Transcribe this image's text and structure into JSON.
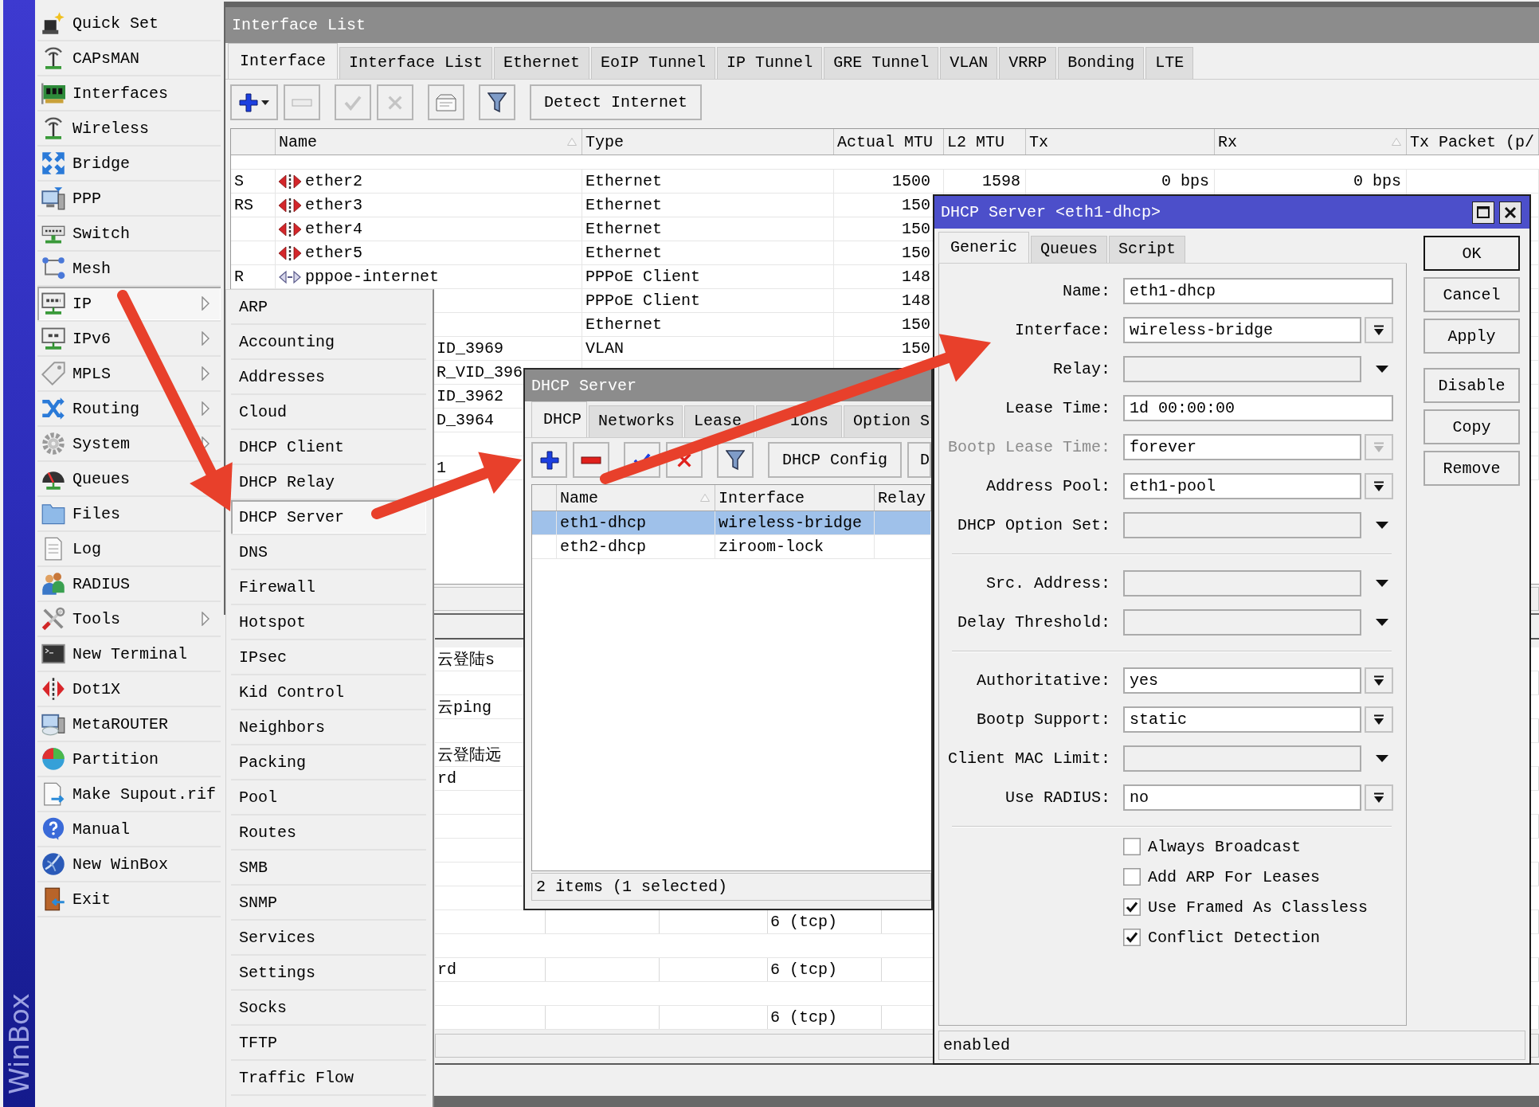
{
  "banner": {
    "title": "WinBox"
  },
  "main_menu": {
    "items": [
      {
        "label": "Quick Set",
        "submenu": false,
        "selected": false
      },
      {
        "label": "CAPsMAN",
        "submenu": false,
        "selected": false
      },
      {
        "label": "Interfaces",
        "submenu": false,
        "selected": false
      },
      {
        "label": "Wireless",
        "submenu": false,
        "selected": false
      },
      {
        "label": "Bridge",
        "submenu": false,
        "selected": false
      },
      {
        "label": "PPP",
        "submenu": false,
        "selected": false
      },
      {
        "label": "Switch",
        "submenu": false,
        "selected": false
      },
      {
        "label": "Mesh",
        "submenu": false,
        "selected": false
      },
      {
        "label": "IP",
        "submenu": true,
        "selected": true
      },
      {
        "label": "IPv6",
        "submenu": true,
        "selected": false
      },
      {
        "label": "MPLS",
        "submenu": true,
        "selected": false
      },
      {
        "label": "Routing",
        "submenu": true,
        "selected": false
      },
      {
        "label": "System",
        "submenu": true,
        "selected": false
      },
      {
        "label": "Queues",
        "submenu": false,
        "selected": false
      },
      {
        "label": "Files",
        "submenu": false,
        "selected": false
      },
      {
        "label": "Log",
        "submenu": false,
        "selected": false
      },
      {
        "label": "RADIUS",
        "submenu": false,
        "selected": false
      },
      {
        "label": "Tools",
        "submenu": true,
        "selected": false
      },
      {
        "label": "New Terminal",
        "submenu": false,
        "selected": false
      },
      {
        "label": "Dot1X",
        "submenu": false,
        "selected": false
      },
      {
        "label": "MetaROUTER",
        "submenu": false,
        "selected": false
      },
      {
        "label": "Partition",
        "submenu": false,
        "selected": false
      },
      {
        "label": "Make Supout.rif",
        "submenu": false,
        "selected": false
      },
      {
        "label": "Manual",
        "submenu": false,
        "selected": false
      },
      {
        "label": "New WinBox",
        "submenu": false,
        "selected": false
      },
      {
        "label": "Exit",
        "submenu": false,
        "selected": false
      }
    ]
  },
  "ip_submenu": {
    "items": [
      {
        "label": "ARP",
        "selected": false
      },
      {
        "label": "Accounting",
        "selected": false
      },
      {
        "label": "Addresses",
        "selected": false
      },
      {
        "label": "Cloud",
        "selected": false
      },
      {
        "label": "DHCP Client",
        "selected": false
      },
      {
        "label": "DHCP Relay",
        "selected": false
      },
      {
        "label": "DHCP Server",
        "selected": true
      },
      {
        "label": "DNS",
        "selected": false
      },
      {
        "label": "Firewall",
        "selected": false
      },
      {
        "label": "Hotspot",
        "selected": false
      },
      {
        "label": "IPsec",
        "selected": false
      },
      {
        "label": "Kid Control",
        "selected": false
      },
      {
        "label": "Neighbors",
        "selected": false
      },
      {
        "label": "Packing",
        "selected": false
      },
      {
        "label": "Pool",
        "selected": false
      },
      {
        "label": "Routes",
        "selected": false
      },
      {
        "label": "SMB",
        "selected": false
      },
      {
        "label": "SNMP",
        "selected": false
      },
      {
        "label": "Services",
        "selected": false
      },
      {
        "label": "Settings",
        "selected": false
      },
      {
        "label": "Socks",
        "selected": false
      },
      {
        "label": "TFTP",
        "selected": false
      },
      {
        "label": "Traffic Flow",
        "selected": false
      }
    ]
  },
  "interface_window": {
    "title": "Interface List",
    "active": false,
    "tabs": [
      {
        "label": "Interface",
        "selected": true
      },
      {
        "label": "Interface List",
        "selected": false
      },
      {
        "label": "Ethernet",
        "selected": false
      },
      {
        "label": "EoIP Tunnel",
        "selected": false
      },
      {
        "label": "IP Tunnel",
        "selected": false
      },
      {
        "label": "GRE Tunnel",
        "selected": false
      },
      {
        "label": "VLAN",
        "selected": false
      },
      {
        "label": "VRRP",
        "selected": false
      },
      {
        "label": "Bonding",
        "selected": false
      },
      {
        "label": "LTE",
        "selected": false
      }
    ],
    "toolbar": [
      {
        "kind": "addmenu",
        "disabled": false
      },
      {
        "kind": "remove",
        "disabled": true
      },
      {
        "kind": "enable",
        "disabled": true
      },
      {
        "kind": "disable",
        "disabled": true
      },
      {
        "kind": "comment",
        "disabled": false
      },
      {
        "kind": "filter",
        "disabled": false
      },
      {
        "kind": "text",
        "label": "Detect Internet",
        "disabled": false
      }
    ],
    "table": {
      "columns": [
        {
          "label": "Name",
          "sorted": true
        },
        {
          "label": "Type",
          "sorted": false
        },
        {
          "label": "Actual MTU",
          "sorted": false
        },
        {
          "label": "L2 MTU",
          "sorted": false
        },
        {
          "label": "Tx",
          "sorted": false
        },
        {
          "label": "Rx",
          "sorted": true
        },
        {
          "label": "Tx Packet (p/",
          "sorted": false
        }
      ],
      "rows": [
        {
          "flags": "S",
          "kind": "ethernet",
          "name": "ether2",
          "type": "Ethernet",
          "actual_mtu": "1500",
          "l2_mtu": "1598",
          "tx": "0 bps",
          "rx": "0 bps"
        },
        {
          "flags": "RS",
          "kind": "ethernet",
          "name": "ether3",
          "type": "Ethernet",
          "actual_mtu": "150"
        },
        {
          "kind": "ethernet",
          "name": "ether4",
          "type": "Ethernet",
          "actual_mtu": "150"
        },
        {
          "kind": "ethernet",
          "name": "ether5",
          "type": "Ethernet",
          "actual_mtu": "150"
        },
        {
          "flags": "R",
          "kind": "pppoe",
          "name": "pppoe-internet",
          "type": "PPPoE Client",
          "actual_mtu": "148"
        },
        {
          "type": "PPPoE Client",
          "actual_mtu": "148"
        },
        {
          "type": "Ethernet",
          "actual_mtu": "150"
        },
        {
          "name": "ID_3969",
          "type": "VLAN",
          "actual_mtu": "150"
        },
        {
          "name": "R_VID_396"
        },
        {
          "name": "ID_3962"
        },
        {
          "name": "D_3964"
        },
        {},
        {
          "name": "1"
        }
      ]
    }
  },
  "rule_window": {
    "rows": [
      {
        "kind": "comment",
        "column_1": "云登陆s"
      },
      {
        "kind": "rule"
      },
      {
        "kind": "comment",
        "column_1": "云ping"
      },
      {
        "kind": "rule"
      },
      {
        "kind": "comment",
        "column_1": "云登陆远"
      },
      {
        "kind": "rule",
        "column_1": "rd"
      },
      {
        "kind": "comment"
      },
      {
        "kind": "rule"
      },
      {
        "kind": "comment"
      },
      {
        "kind": "rule"
      },
      {
        "kind": "comment"
      },
      {
        "kind": "rule",
        "column_4": "6 (tcp)"
      },
      {
        "kind": "comment"
      },
      {
        "kind": "rule",
        "column_1": "rd",
        "column_4": "6 (tcp)"
      },
      {
        "kind": "comment"
      },
      {
        "kind": "rule",
        "column_4": "6 (tcp)"
      }
    ]
  },
  "dhcp_list_window": {
    "title": "DHCP Server",
    "active": false,
    "tabs": [
      {
        "label": "DHCP",
        "selected": true
      },
      {
        "label": "Networks",
        "selected": false
      },
      {
        "label": "Lease",
        "selected": false
      },
      {
        "label": "ions",
        "selected": false
      },
      {
        "label": "Option S",
        "selected": false
      }
    ],
    "toolbar": [
      {
        "kind": "add",
        "disabled": false
      },
      {
        "kind": "remove",
        "disabled": false
      },
      {
        "kind": "enable",
        "disabled": false
      },
      {
        "kind": "disable",
        "disabled": false
      },
      {
        "kind": "filter",
        "disabled": false
      },
      {
        "kind": "text",
        "label": "DHCP Config",
        "disabled": false
      },
      {
        "kind": "text",
        "label": "D",
        "disabled": false
      }
    ],
    "table": {
      "columns": [
        {
          "label": "Name",
          "sorted": true
        },
        {
          "label": "Interface",
          "sorted": false
        },
        {
          "label": "Relay",
          "sorted": false
        }
      ],
      "rows": [
        {
          "name": "eth1-dhcp",
          "interface": "wireless-bridge",
          "selected": true
        },
        {
          "name": "eth2-dhcp",
          "interface": "ziroom-lock",
          "selected": false
        }
      ]
    },
    "footer": "2 items (1 selected)"
  },
  "dhcp_dialog": {
    "title": "DHCP Server <eth1-dhcp>",
    "active": true,
    "tabs": [
      {
        "label": "Generic",
        "selected": true
      },
      {
        "label": "Queues",
        "selected": false
      },
      {
        "label": "Script",
        "selected": false
      }
    ],
    "sections": [
      [
        {
          "label": "Name:",
          "kind": "text",
          "value": "eth1-dhcp",
          "disabled": false
        },
        {
          "label": "Interface:",
          "kind": "combo",
          "value": "wireless-bridge",
          "disabled": false
        },
        {
          "label": "Relay:",
          "kind": "optional",
          "disabled": false
        },
        {
          "label": "Lease Time:",
          "kind": "text",
          "value": "1d 00:00:00",
          "disabled": false
        },
        {
          "label": "Bootp Lease Time:",
          "kind": "combo",
          "value": "forever",
          "disabled": true
        },
        {
          "label": "Address Pool:",
          "kind": "combo",
          "value": "eth1-pool",
          "disabled": false
        },
        {
          "label": "DHCP Option Set:",
          "kind": "optional",
          "disabled": false
        }
      ],
      [
        {
          "label": "Src. Address:",
          "kind": "optional",
          "disabled": false
        },
        {
          "label": "Delay Threshold:",
          "kind": "optional",
          "disabled": false
        }
      ],
      [
        {
          "label": "Authoritative:",
          "kind": "combo",
          "value": "yes",
          "disabled": false
        },
        {
          "label": "Bootp Support:",
          "kind": "combo",
          "value": "static",
          "disabled": false
        },
        {
          "label": "Client MAC Limit:",
          "kind": "optional",
          "disabled": false
        },
        {
          "label": "Use RADIUS:",
          "kind": "combo",
          "value": "no",
          "disabled": false
        }
      ]
    ],
    "checkboxes": [
      {
        "label": "Always Broadcast",
        "checked": false
      },
      {
        "label": "Add ARP For Leases",
        "checked": false
      },
      {
        "label": "Use Framed As Classless",
        "checked": true
      },
      {
        "label": "Conflict Detection",
        "checked": true
      }
    ],
    "button_groups": [
      [
        {
          "label": "OK",
          "default": true
        },
        {
          "label": "Cancel",
          "default": false
        },
        {
          "label": "Apply",
          "default": false
        }
      ],
      [
        {
          "label": "Disable",
          "default": false
        },
        {
          "label": "Copy",
          "default": false
        },
        {
          "label": "Remove",
          "default": false
        }
      ]
    ],
    "status": "enabled"
  }
}
